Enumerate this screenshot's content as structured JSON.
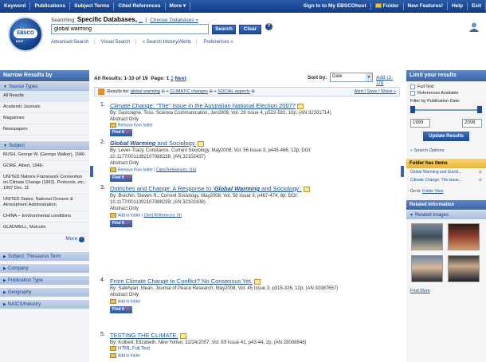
{
  "navbar": {
    "left": [
      "Keyword",
      "Publications",
      "Subject Terms",
      "Cited References",
      "More ▾"
    ],
    "right": [
      "Sign In to My EBSCOhost",
      "Folder",
      "New Features!",
      "Help",
      "Exit"
    ]
  },
  "logo": {
    "text": "EBSCO",
    "sub": "HOST"
  },
  "search": {
    "searching_label": "Searching:",
    "databases": "Specific Databases,",
    "more": "...",
    "choose_databases": "Choose Databases »",
    "query": "global warming",
    "search_button": "Search",
    "clear_button": "Clear",
    "help": "?",
    "links": [
      "Advanced Search",
      "Visual Search",
      "» Search History/Alerts",
      "Preferences »"
    ]
  },
  "left": {
    "title": "Narrow Results by",
    "source_types": {
      "header": "Source Types",
      "items": [
        "All Results",
        "Academic Journals",
        "Magazines",
        "Newspapers"
      ]
    },
    "subject": {
      "header": "Subject",
      "items": [
        "BUSH, George W. (George Walker), 1946-",
        "GORE, Albert, 1948-",
        "UNITED Nations Framework Convention on Climate Change (1992). Protocols, etc., 1997 Dec. 11",
        "UNITED States. National Oceanic & Atmospheric Administration",
        "CHINA -- Environmental conditions",
        "GLADWELL, Malcolm"
      ],
      "more": "More"
    },
    "collapsed": [
      "Subject: Thesaurus Term",
      "Company",
      "Publication Type",
      "Geography",
      "NAICS/Industry"
    ]
  },
  "toolbar": {
    "all_results": "All Results: 1-10 of 19",
    "page_label": "Page: 1",
    "page_2": "2",
    "next": "Next",
    "sort_label": "Sort by:",
    "sort_value": "Date",
    "add_link": "Add (1-10)"
  },
  "resultbar": {
    "label": "Results for:",
    "terms": [
      "global warming",
      "CLIMATIC changes",
      "SOCIAL aspects"
    ],
    "alert": "Alert / Save / Share »"
  },
  "results": [
    {
      "num": "1.",
      "title": "Climate Change: \"The\" Issue in the Australian National Election 2007?",
      "meta": [
        "By: Gascoigne, Toss. Science Communication, Jun2008, Vol. 29 Issue 4, p522-531, 10p; (AN 32201714)",
        "Abstract Only"
      ],
      "action": "Remove from folder",
      "findit": "Find It"
    },
    {
      "num": "2.",
      "title_em": "Global Warming",
      "title_rest": " and Sociology.",
      "meta": [
        "By: Lever-Tracy, Constance. Current Sociology, May2008, Vol. 56 Issue 3, p445-466, 12p; DOI:",
        "10.1177/0011392107088238; (AN 32102437)",
        "Abstract Only"
      ],
      "action": "Remove from folder",
      "cited": "Cited References: (16)",
      "findit": "Find It"
    },
    {
      "num": "3.",
      "title_pre": "Ostriches and Change: A Response to '",
      "title_em": "Global Warming",
      "title_rest": " and Sociology'.",
      "meta": [
        "By: Brechin, Steven R.. Current Sociology, May2008, Vol. 56 Issue 3, p467-474, 8p; DOI:",
        "10.1177/0011392107088239; (AN 32102438)",
        "Abstract Only"
      ],
      "action": "Add to folder",
      "cited": "Cited References: (9)",
      "findit": "Find It"
    },
    {
      "num": "4.",
      "title": "From Climate Change to Conflict? No Consensus Yet.",
      "meta": [
        "By: Salehyan, Idean. Journal of Peace Research, May2008, Vol. 45 Issue 3, p315-326, 12p; (AN 31987657)",
        "Abstract Only"
      ],
      "action": "Add to folder",
      "findit": "Find It"
    },
    {
      "num": "5.",
      "title": "TESTING THE CLIMATE.",
      "meta": [
        "By: Kolbert, Elizabeth. New Yorker, 12/24/2007, Vol. 83 Issue 41, p43-44, 2p; (AN 28008848)"
      ],
      "html": "HTML Full Text",
      "action": "Add to folder"
    }
  ],
  "right": {
    "limit_title": "Limit your results",
    "full_text": "Full Text",
    "references": "References Available",
    "pub_date_label": "Filter by Publication Date:",
    "date_from": "1999",
    "date_to": "2008",
    "update_button": "Update Results",
    "search_options": "« Search Options",
    "folder_title": "Folder has items",
    "folder_items": [
      "Global Warming and Sociol...",
      "Climate Change: The Issue..."
    ],
    "goto_label": "Go to:",
    "folder_view": "Folder View",
    "related_title": "Related Information",
    "related_images": "Related Images",
    "find_more": "Find More"
  }
}
